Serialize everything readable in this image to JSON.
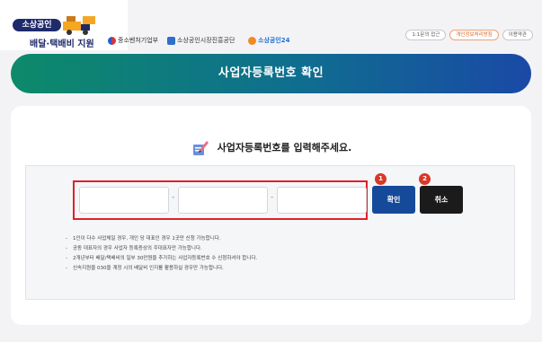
{
  "header": {
    "logo_top": "소상공인",
    "logo_sub": "배달·택배비 지원",
    "orgs": [
      {
        "label": "중소벤처기업부"
      },
      {
        "label": "소상공인시장진흥공단"
      },
      {
        "label": "소상공인24"
      }
    ],
    "links": [
      "1:1문의 접근",
      "개인정보처리방침",
      "이용약관"
    ]
  },
  "banner": {
    "title": "사업자등록번호 확인"
  },
  "main": {
    "prompt": "사업자등록번호를 입력해주세요.",
    "separators": [
      "-",
      "-"
    ],
    "confirm_label": "확인",
    "cancel_label": "취소",
    "badges": [
      "1",
      "2"
    ],
    "notes": [
      "1인이 다수 사업체일 경우, 개인 당 대표인 경우 1곳만 신청 가능합니다.",
      "공동 대표자의 경우 사업자 등록증상의 주대표자만 가능합니다.",
      "2개년부터 배달/택배비의 일부 30만원을 추가하는 사업자등록번호 수 신청하셔야 합니다.",
      "신속지원을 030을 계정 시의 배달비 인지를 활용하실 경우만 가능합니다."
    ]
  },
  "colors": {
    "brand_navy": "#1f2a6b",
    "banner_start": "#0d8a6a",
    "banner_end": "#1a49a6",
    "confirm_button": "#154a9b",
    "cancel_button": "#1b1b1b",
    "highlight_red": "#e0202a"
  }
}
